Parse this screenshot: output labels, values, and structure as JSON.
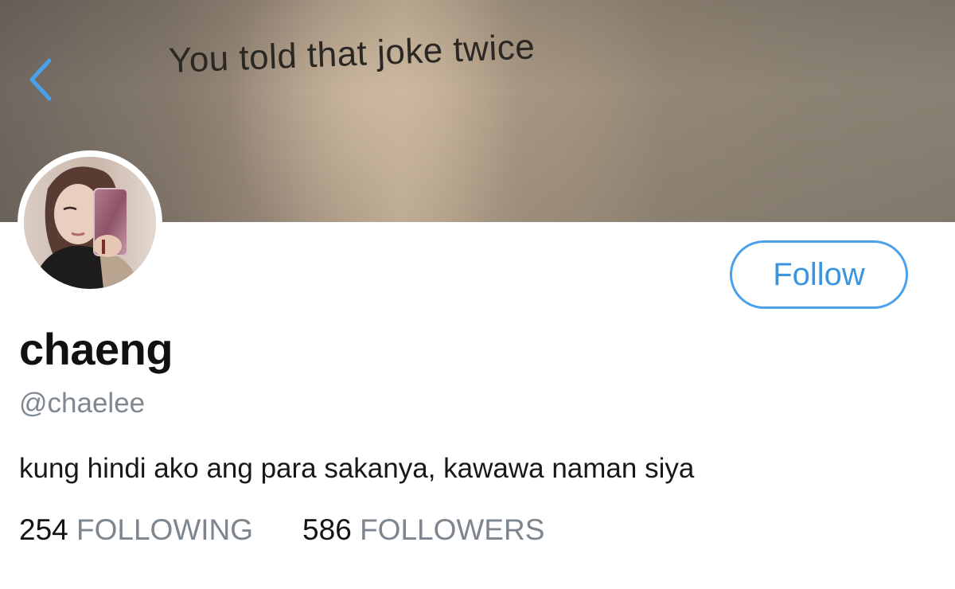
{
  "banner": {
    "text": "You told that joke twice"
  },
  "navigation": {
    "back_icon": "chevron-left-icon"
  },
  "profile": {
    "display_name": "chaeng",
    "handle": "@chaelee",
    "bio": "kung hindi ako ang para sakanya, kawawa naman siya"
  },
  "actions": {
    "follow_label": "Follow"
  },
  "stats": {
    "following_count": "254",
    "following_label": "FOLLOWING",
    "followers_count": "586",
    "followers_label": "FOLLOWERS"
  },
  "colors": {
    "accent": "#4aa1eb",
    "secondary_text": "#7f8890",
    "primary_text": "#111111"
  }
}
